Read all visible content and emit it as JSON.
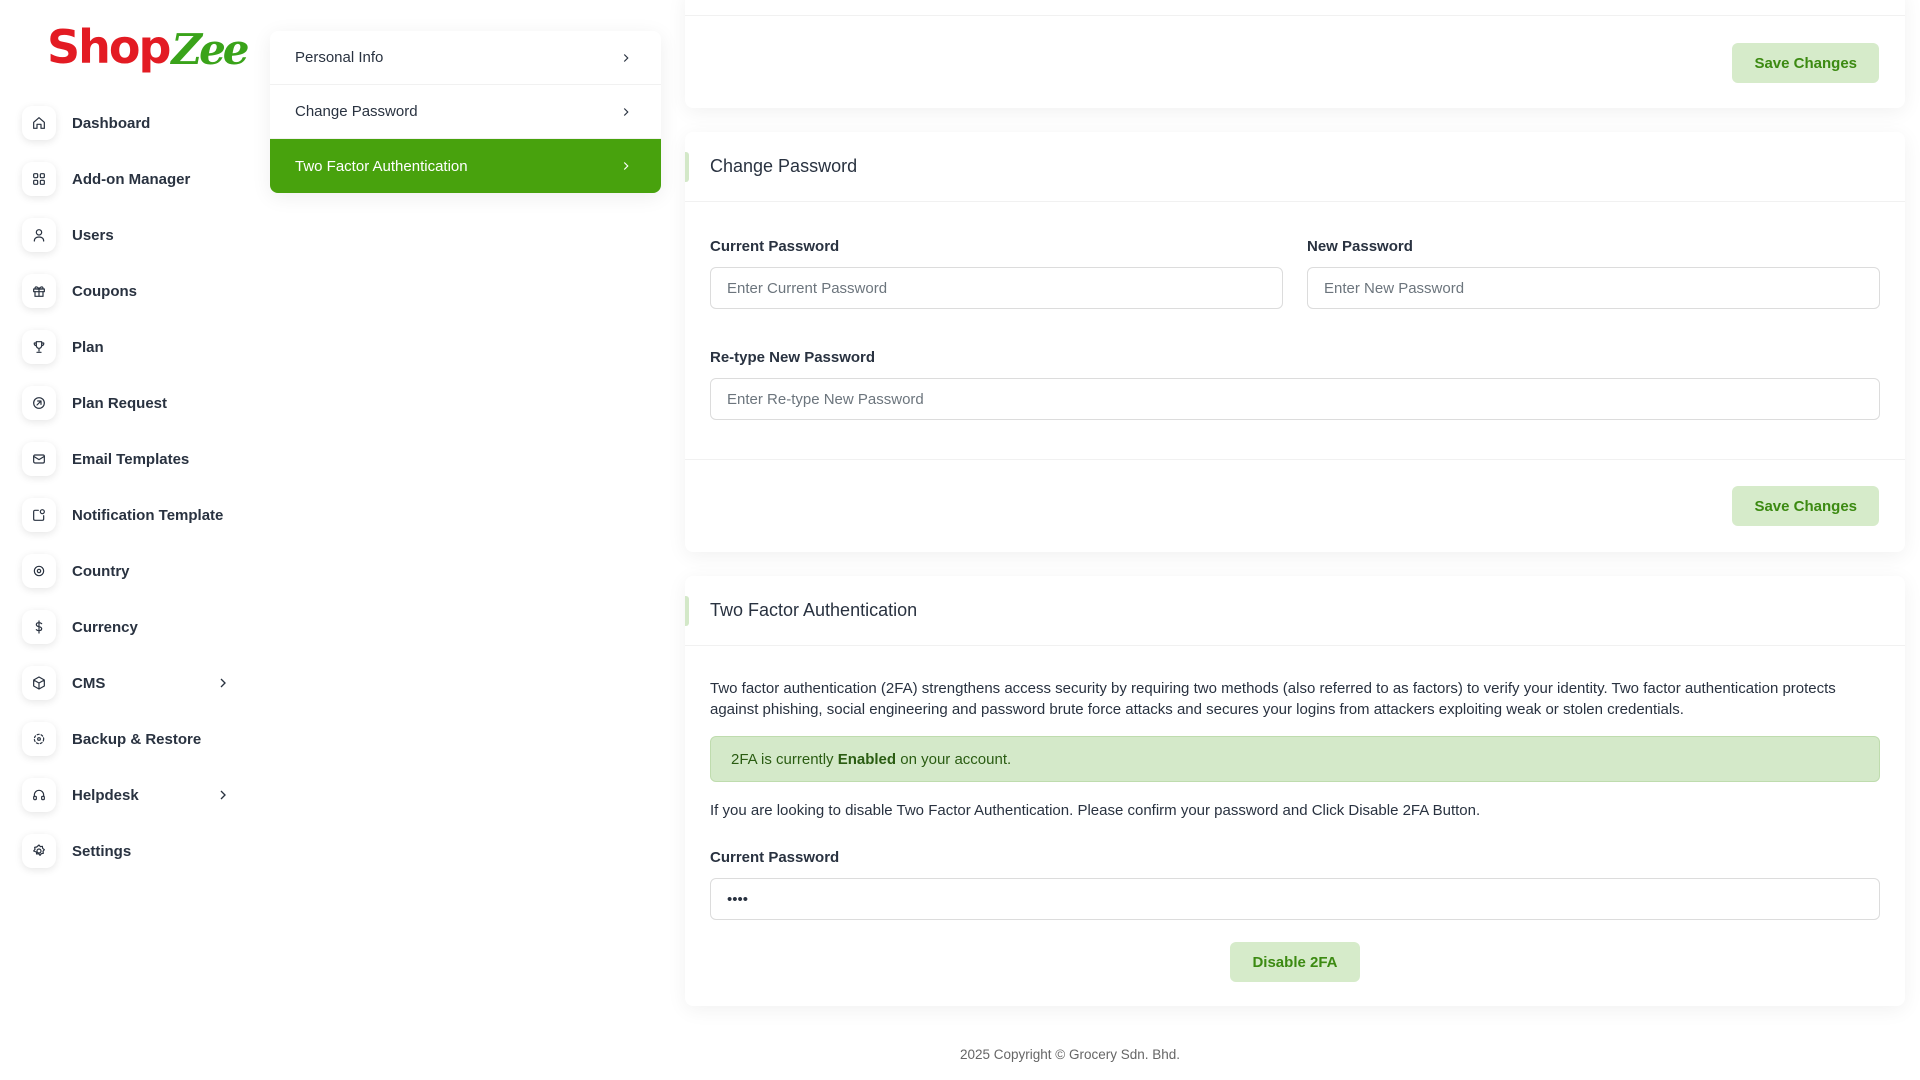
{
  "brand": {
    "logo_shop": "Shop",
    "logo_zee": "Zee",
    "red": "#e31b23",
    "green": "#3aa31a"
  },
  "sidebar": {
    "items": [
      {
        "label": "Dashboard",
        "icon": "home-icon"
      },
      {
        "label": "Add-on Manager",
        "icon": "grid-icon"
      },
      {
        "label": "Users",
        "icon": "user-icon"
      },
      {
        "label": "Coupons",
        "icon": "gift-icon"
      },
      {
        "label": "Plan",
        "icon": "trophy-icon"
      },
      {
        "label": "Plan Request",
        "icon": "arrow-circle-icon"
      },
      {
        "label": "Email Templates",
        "icon": "mail-icon"
      },
      {
        "label": "Notification Template",
        "icon": "notification-icon"
      },
      {
        "label": "Country",
        "icon": "target-icon"
      },
      {
        "label": "Currency",
        "icon": "dollar-icon"
      },
      {
        "label": "CMS",
        "icon": "box-icon",
        "has_submenu": true
      },
      {
        "label": "Backup & Restore",
        "icon": "backup-icon"
      },
      {
        "label": "Helpdesk",
        "icon": "headset-icon",
        "has_submenu": true
      },
      {
        "label": "Settings",
        "icon": "gear-icon"
      }
    ]
  },
  "settings_menu": {
    "items": [
      {
        "label": "Personal Info",
        "active": false
      },
      {
        "label": "Change Password",
        "active": false
      },
      {
        "label": "Two Factor Authentication",
        "active": true
      }
    ],
    "active_color": "#48a20d"
  },
  "top_card": {
    "save_label": "Save Changes"
  },
  "change_password": {
    "title": "Change Password",
    "current_label": "Current Password",
    "current_placeholder": "Enter Current Password",
    "new_label": "New Password",
    "new_placeholder": "Enter New Password",
    "retype_label": "Re-type New Password",
    "retype_placeholder": "Enter Re-type New Password",
    "save_label": "Save Changes"
  },
  "two_factor": {
    "title": "Two Factor Authentication",
    "description": "Two factor authentication (2FA) strengthens access security by requiring two methods (also referred to as factors) to verify your identity. Two factor authentication protects against phishing, social engineering and password brute force attacks and secures your logins from attackers exploiting weak or stolen credentials.",
    "status_prefix": "2FA is currently ",
    "status_value": "Enabled",
    "status_suffix": " on your account.",
    "note": "If you are looking to disable Two Factor Authentication. Please confirm your password and Click Disable 2FA Button.",
    "password_label": "Current Password",
    "password_value": "••••",
    "disable_label": "Disable 2FA"
  },
  "footer": {
    "text": "2025  Copyright © Grocery Sdn. Bhd."
  }
}
